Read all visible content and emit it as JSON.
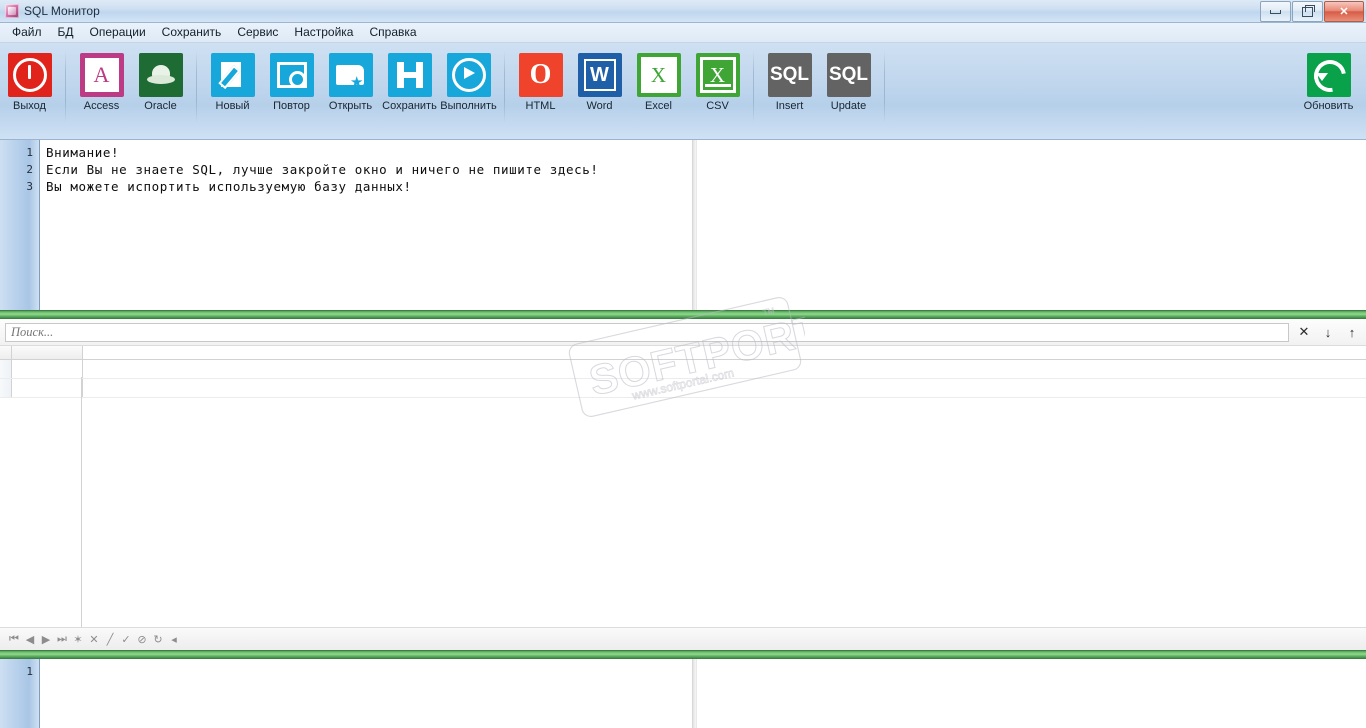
{
  "window": {
    "title": "SQL Монитор",
    "icon": "app-icon",
    "buttons": {
      "minimize": "minimize-icon",
      "maximize": "restore-icon",
      "close": "✕"
    }
  },
  "menu": {
    "items": [
      {
        "label": "Файл",
        "name": "menu-file"
      },
      {
        "label": "БД",
        "name": "menu-db"
      },
      {
        "label": "Операции",
        "name": "menu-operations"
      },
      {
        "label": "Сохранить",
        "name": "menu-save"
      },
      {
        "label": "Сервис",
        "name": "menu-service"
      },
      {
        "label": "Настройка",
        "name": "menu-settings"
      },
      {
        "label": "Справка",
        "name": "menu-help"
      }
    ]
  },
  "toolbar": {
    "groups": [
      {
        "name": "group-exit",
        "buttons": [
          {
            "label": "Выход",
            "icon": "power-icon",
            "color": "#e0241c",
            "name": "toolbar-exit"
          }
        ]
      },
      {
        "name": "group-databases",
        "buttons": [
          {
            "label": "Access",
            "icon": "access-icon",
            "color": "#bd3b84",
            "name": "toolbar-access"
          },
          {
            "label": "Oracle",
            "icon": "oracle-frog-icon",
            "color": "#1e6b33",
            "name": "toolbar-oracle"
          }
        ]
      },
      {
        "name": "group-file",
        "buttons": [
          {
            "label": "Новый",
            "icon": "new-document-icon",
            "color": "#17a7db",
            "name": "toolbar-new"
          },
          {
            "label": "Повтор",
            "icon": "repeat-preview-icon",
            "color": "#17a7db",
            "name": "toolbar-repeat"
          },
          {
            "label": "Открыть",
            "icon": "open-folder-icon",
            "color": "#17a7db",
            "name": "toolbar-open"
          },
          {
            "label": "Сохранить",
            "icon": "save-floppy-icon",
            "color": "#17a7db",
            "name": "toolbar-save"
          },
          {
            "label": "Выполнить",
            "icon": "play-execute-icon",
            "color": "#17a7db",
            "name": "toolbar-execute"
          }
        ]
      },
      {
        "name": "group-export",
        "buttons": [
          {
            "label": "HTML",
            "icon": "html-opera-icon",
            "color": "#f0432b",
            "name": "toolbar-html"
          },
          {
            "label": "Word",
            "icon": "word-icon",
            "color": "#1f5fa8",
            "name": "toolbar-word"
          },
          {
            "label": "Excel",
            "icon": "excel-icon",
            "color": "#3fa535",
            "name": "toolbar-excel"
          },
          {
            "label": "CSV",
            "icon": "csv-icon",
            "color": "#3fa535",
            "name": "toolbar-csv"
          }
        ]
      },
      {
        "name": "group-sql",
        "buttons": [
          {
            "label": "Insert",
            "icon": "sql-insert-icon",
            "color": "#636363",
            "name": "toolbar-insert"
          },
          {
            "label": "Update",
            "icon": "sql-update-icon",
            "color": "#636363",
            "name": "toolbar-update"
          }
        ]
      }
    ],
    "right": {
      "label": "Обновить",
      "icon": "refresh-icon",
      "color": "#0aa14b",
      "name": "toolbar-refresh"
    }
  },
  "editor": {
    "line_numbers": [
      "1",
      "2",
      "3"
    ],
    "lines": [
      "Внимание!",
      "Если Вы не знаете SQL, лучше закройте окно и ничего не пишите здесь!",
      "Вы можете испортить используемую базу данных!"
    ]
  },
  "search": {
    "placeholder": "Поиск...",
    "value": "",
    "buttons": [
      {
        "glyph": "✕",
        "name": "search-close-button"
      },
      {
        "glyph": "↓",
        "name": "search-find-next-button"
      },
      {
        "glyph": "↑",
        "name": "search-find-prev-button"
      }
    ]
  },
  "grid": {
    "columns": [
      ""
    ],
    "rows": [
      [
        ""
      ],
      [
        ""
      ]
    ]
  },
  "navigator": {
    "buttons": [
      {
        "glyph": "⏮",
        "name": "nav-first-button",
        "title": "First"
      },
      {
        "glyph": "◀",
        "name": "nav-prior-button",
        "title": "Prior"
      },
      {
        "glyph": "▶",
        "name": "nav-next-button",
        "title": "Next"
      },
      {
        "glyph": "⏭",
        "name": "nav-last-button",
        "title": "Last"
      },
      {
        "glyph": "✶",
        "name": "nav-insert-button",
        "title": "Insert"
      },
      {
        "glyph": "✕",
        "name": "nav-delete-button",
        "title": "Delete"
      },
      {
        "glyph": "╱",
        "name": "nav-edit-button",
        "title": "Edit"
      },
      {
        "glyph": "✓",
        "name": "nav-post-button",
        "title": "Post"
      },
      {
        "glyph": "⊘",
        "name": "nav-cancel-button",
        "title": "Cancel"
      },
      {
        "glyph": "↻",
        "name": "nav-refresh-button",
        "title": "Refresh"
      },
      {
        "glyph": "◂",
        "name": "nav-more-button",
        "title": "More"
      }
    ]
  },
  "bottom_editor": {
    "line_numbers": [
      "1"
    ],
    "lines": [
      ""
    ]
  },
  "watermark": {
    "primary": "SOFTPORTAL",
    "secondary": "www.softportal.com",
    "tm": "TM"
  },
  "colors": {
    "splitter_green": "#6fbf6f",
    "titlebar": "#cfe0f2",
    "toolbar": "#c3d8ee",
    "close_red": "#d75c46"
  }
}
